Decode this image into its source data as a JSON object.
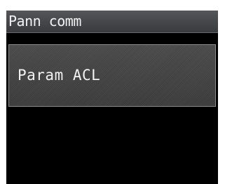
{
  "screen": {
    "title": "Pann comm",
    "menu_items": [
      {
        "label": "Param ACL"
      }
    ]
  },
  "colors": {
    "screen_background": "#000000",
    "title_bar": "#4a4b4f",
    "menu_item_background": "#3f3f3f",
    "menu_item_border": "#8c8c8c",
    "text": "#f2f2f2"
  }
}
